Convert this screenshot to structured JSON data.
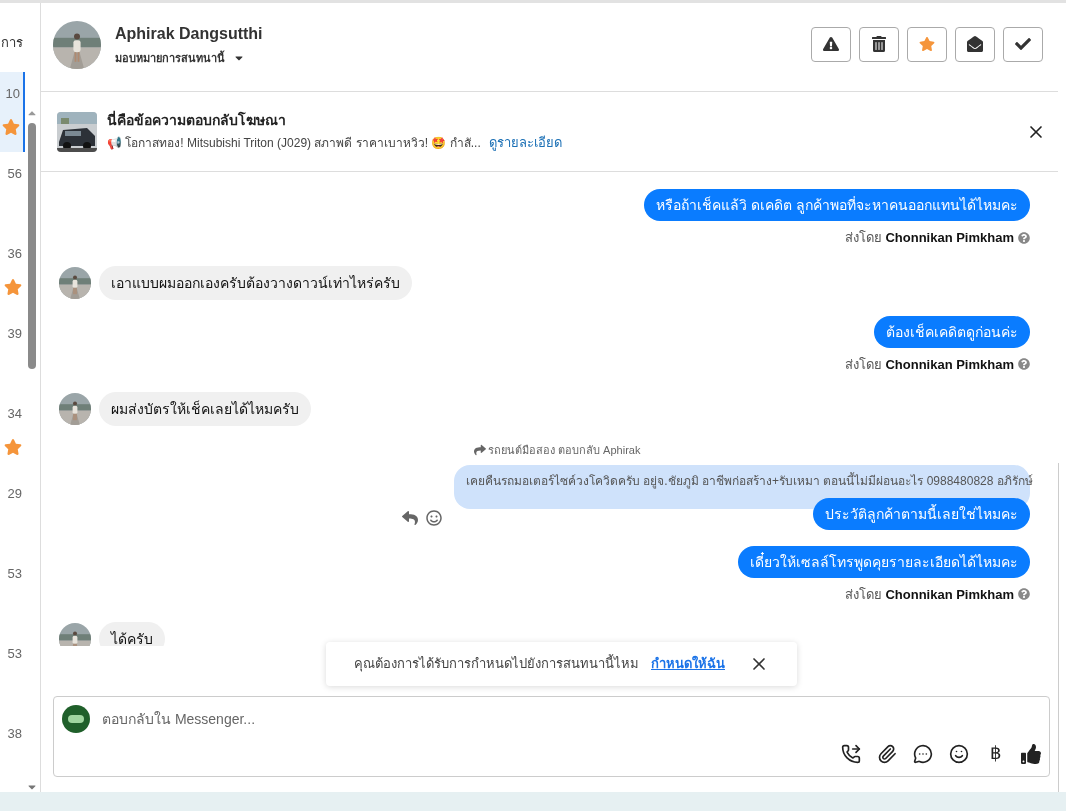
{
  "sidebar": {
    "header": "การ",
    "items": [
      {
        "time": "10",
        "starred": true,
        "selected": true
      },
      {
        "time": "56",
        "starred": false,
        "selected": false
      },
      {
        "time": "36",
        "starred": true,
        "selected": false
      },
      {
        "time": "39",
        "starred": false,
        "selected": false
      },
      {
        "time": "34",
        "starred": true,
        "selected": false
      },
      {
        "time": "29",
        "starred": false,
        "selected": false
      },
      {
        "time": "53",
        "starred": false,
        "selected": false
      },
      {
        "time": "53",
        "starred": false,
        "selected": false
      },
      {
        "time": "38",
        "starred": false,
        "selected": false
      }
    ]
  },
  "header": {
    "name": "Aphirak Dangsutthi",
    "assign": "มอบหมายการสนทนานี้",
    "actions": [
      {
        "kind": "report"
      },
      {
        "kind": "delete"
      },
      {
        "kind": "star",
        "on": true
      },
      {
        "kind": "mark_unread"
      },
      {
        "kind": "done"
      }
    ]
  },
  "ad_banner": {
    "title": "นี่คือข้อความตอบกลับโฆษณา",
    "text": "📢 โอกาสทอง! Mitsubishi Triton (J029) สภาพดี ราคาเบาหวิว! 🤩 กำสั...",
    "link": "ดูรายละเอียด"
  },
  "messages": [
    {
      "kind": "outgoing",
      "text": "หรือถ้าเช็คแล้วิ ดเคดิต ลูกค้าพอที่จะหาคนออกแทนได้ไหมคะ"
    },
    {
      "kind": "sent_by",
      "prefix": "ส่งโดย",
      "name": "Chonnikan Pimkham"
    },
    {
      "kind": "incoming",
      "text": "เอาแบบผมออกเองครับต้องวางดาวน์เท่าไหร่ครับ"
    },
    {
      "kind": "outgoing",
      "text": "ต้องเช็คเคดิตดูก่อนค่ะ"
    },
    {
      "kind": "sent_by",
      "prefix": "ส่งโดย",
      "name": "Chonnikan Pimkham"
    },
    {
      "kind": "incoming",
      "text": "ผมส่งบัตรให้เช็คเลยได้ไหมครับ"
    },
    {
      "kind": "reply",
      "label": "รถยนต์มือสอง ตอบกลับ Aphirak",
      "quoted": "เคยคืนรถมอเตอร์ไซค์วงโควิดครับ อยู่จ.ชัยภูมิ อาชีพก่อสร้าง+รับเหมา ตอนนี้ไม่มีผ่อนอะไร 0988480828 อภิรักษ์",
      "text": "ประวัติลูกค้าตามนี้เลยใช่ไหมคะ"
    },
    {
      "kind": "outgoing",
      "text": "เดี๋ยวให้เซลล์โทรพูดคุยรายละเอียดได้ไหมคะ"
    },
    {
      "kind": "sent_by",
      "prefix": "ส่งโดย",
      "name": "Chonnikan Pimkham"
    },
    {
      "kind": "incoming",
      "text": "ได้ครับ"
    }
  ],
  "toast": {
    "text": "คุณต้องการได้รับการกำหนดไปยังการสนทนานี้ไหม",
    "link": "กำหนดให้ฉัน"
  },
  "composer": {
    "placeholder": "ตอบกลับใน Messenger...",
    "tools": [
      {
        "kind": "call"
      },
      {
        "kind": "attach"
      },
      {
        "kind": "quick_reply"
      },
      {
        "kind": "emoji"
      },
      {
        "kind": "text",
        "label": "฿"
      },
      {
        "kind": "like"
      }
    ]
  }
}
